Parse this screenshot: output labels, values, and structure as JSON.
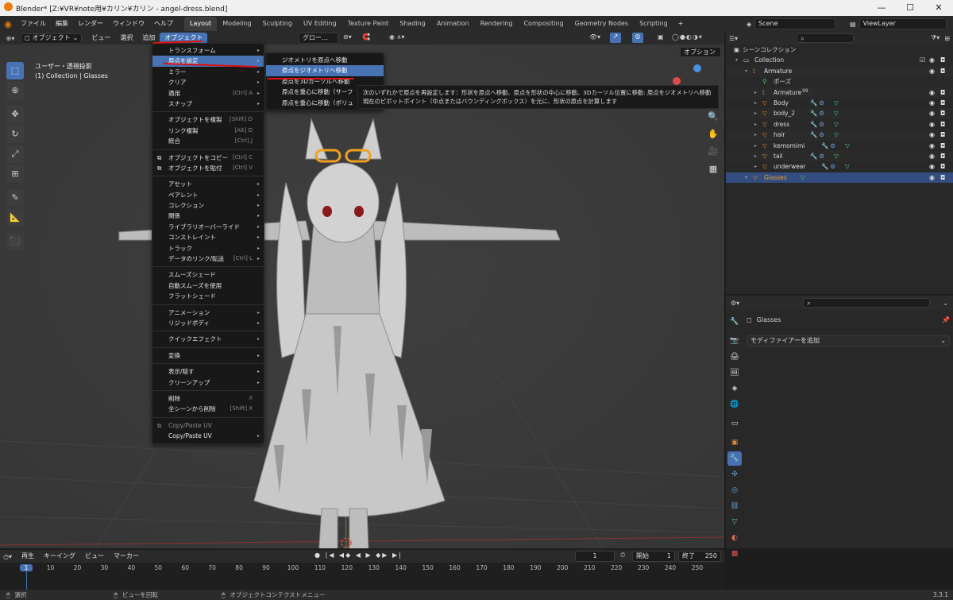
{
  "window": {
    "title": "Blender* [Z:¥VR¥note用¥カリン¥カリン - angel-dress.blend]",
    "minimize": "—",
    "maximize": "☐",
    "close": "✕"
  },
  "topbar": {
    "menus": [
      "ファイル",
      "編集",
      "レンダー",
      "ウィンドウ",
      "ヘルプ"
    ],
    "workspaces": [
      "Layout",
      "Modeling",
      "Sculpting",
      "UV Editing",
      "Texture Paint",
      "Shading",
      "Animation",
      "Rendering",
      "Compositing",
      "Geometry Nodes",
      "Scripting"
    ],
    "active_workspace": "Layout",
    "add_tab": "+",
    "scene": "Scene",
    "view_layer": "ViewLayer"
  },
  "viewport_header": {
    "mode": "オブジェクト",
    "menus": [
      "ビュー",
      "選択",
      "追加"
    ],
    "active_menu": "オブジェクト",
    "transform_orientation": "グロー…",
    "options_button": "オプション"
  },
  "viewport": {
    "view_name": "ユーザー・透視投影",
    "collection_info": "(1) Collection | Glasses"
  },
  "object_menu": {
    "items": [
      {
        "label": "トランスフォーム",
        "shortcut": "",
        "submenu": true
      },
      {
        "label": "原点を設定",
        "shortcut": "",
        "submenu": true,
        "highlight": true
      },
      {
        "label": "ミラー",
        "shortcut": "",
        "submenu": true
      },
      {
        "label": "クリア",
        "shortcut": "",
        "submenu": true
      },
      {
        "label": "適用",
        "shortcut": "[Ctrl] A",
        "submenu": true
      },
      {
        "label": "スナップ",
        "shortcut": "",
        "submenu": true
      },
      {
        "sep": true
      },
      {
        "label": "オブジェクトを複製",
        "shortcut": "[Shift] D"
      },
      {
        "label": "リンク複製",
        "shortcut": "[Alt] D"
      },
      {
        "label": "統合",
        "shortcut": "[Ctrl] J"
      },
      {
        "sep": true
      },
      {
        "label": "オブジェクトをコピー",
        "shortcut": "[Ctrl] C",
        "icon": "⧉"
      },
      {
        "label": "オブジェクトを貼付",
        "shortcut": "[Ctrl] V",
        "icon": "⧉"
      },
      {
        "sep": true
      },
      {
        "label": "アセット",
        "shortcut": "",
        "submenu": true
      },
      {
        "label": "ペアレント",
        "shortcut": "",
        "submenu": true
      },
      {
        "label": "コレクション",
        "shortcut": "",
        "submenu": true
      },
      {
        "label": "関係",
        "shortcut": "",
        "submenu": true
      },
      {
        "label": "ライブラリオーバーライド",
        "shortcut": "",
        "submenu": true
      },
      {
        "label": "コンストレイント",
        "shortcut": "",
        "submenu": true
      },
      {
        "label": "トラック",
        "shortcut": "",
        "submenu": true
      },
      {
        "label": "データのリンク/転送",
        "shortcut": "[Ctrl] L",
        "submenu": true
      },
      {
        "sep": true
      },
      {
        "label": "スムーズシェード",
        "shortcut": ""
      },
      {
        "label": "自動スムーズを使用",
        "shortcut": ""
      },
      {
        "label": "フラットシェード",
        "shortcut": ""
      },
      {
        "sep": true
      },
      {
        "label": "アニメーション",
        "shortcut": "",
        "submenu": true
      },
      {
        "label": "リジッドボディ",
        "shortcut": "",
        "submenu": true
      },
      {
        "sep": true
      },
      {
        "label": "クイックエフェクト",
        "shortcut": "",
        "submenu": true
      },
      {
        "sep": true
      },
      {
        "label": "変換",
        "shortcut": "",
        "submenu": true
      },
      {
        "sep": true
      },
      {
        "label": "表示/隠す",
        "shortcut": "",
        "submenu": true
      },
      {
        "label": "クリーンアップ",
        "shortcut": "",
        "submenu": true
      },
      {
        "sep": true
      },
      {
        "label": "削除",
        "shortcut": "X"
      },
      {
        "label": "全シーンから削除",
        "shortcut": "[Shift] X"
      },
      {
        "sep": true
      },
      {
        "label": "Copy/Paste UV",
        "shortcut": "",
        "dim": true,
        "icon": "⧉"
      },
      {
        "label": "Copy/Paste UV",
        "shortcut": "",
        "submenu": true
      }
    ]
  },
  "origin_submenu": {
    "items": [
      {
        "label": "ジオメトリを原点へ移動",
        "highlight": false
      },
      {
        "label": "原点をジオメトリへ移動",
        "highlight": true
      },
      {
        "label": "原点を3Dカーソルへ移動",
        "highlight": false
      },
      {
        "label": "原点を重心に移動（サーフ",
        "highlight": false
      },
      {
        "label": "原点を重心に移動（ボリュ",
        "highlight": false
      }
    ]
  },
  "tooltip": {
    "line1": "次のいずれかで原点を再設定します：形状を原点へ移動、原点を形状の中心に移動、3Dカーソル位置に移動: 原点をジオメトリへ移動",
    "line2": "現在のピボットポイント（中点またはバウンディングボックス）を元に、形状の原点を計算します"
  },
  "outliner": {
    "title": "シーンコレクション",
    "rows": [
      {
        "label": "Collection",
        "indent": 1,
        "icon": "collection",
        "checkbox": true
      },
      {
        "label": "Armature",
        "indent": 2,
        "icon": "armature"
      },
      {
        "label": "ポーズ",
        "indent": 3,
        "icon": "pose"
      },
      {
        "label": "Armature",
        "indent": 3,
        "icon": "armature-data",
        "extra": "99"
      },
      {
        "label": "Body",
        "indent": 3,
        "icon": "mesh"
      },
      {
        "label": "body_2",
        "indent": 3,
        "icon": "mesh"
      },
      {
        "label": "dress",
        "indent": 3,
        "icon": "mesh"
      },
      {
        "label": "hair",
        "indent": 3,
        "icon": "mesh"
      },
      {
        "label": "kemomimi",
        "indent": 3,
        "icon": "mesh"
      },
      {
        "label": "tail",
        "indent": 3,
        "icon": "mesh"
      },
      {
        "label": "underwear",
        "indent": 3,
        "icon": "mesh"
      },
      {
        "label": "Glasses",
        "indent": 2,
        "icon": "mesh",
        "selected": true
      }
    ]
  },
  "properties": {
    "object_name": "Glasses",
    "add_modifier": "モディファイアーを追加"
  },
  "timeline": {
    "menus": [
      "再生",
      "キーイング",
      "ビュー",
      "マーカー"
    ],
    "current_frame": "1",
    "start_label": "開始",
    "start": "1",
    "end_label": "終了",
    "end": "250",
    "ticks": [
      "1",
      "10",
      "20",
      "30",
      "40",
      "50",
      "60",
      "70",
      "80",
      "90",
      "100",
      "110",
      "120",
      "130",
      "140",
      "150",
      "160",
      "170",
      "180",
      "190",
      "200",
      "210",
      "220",
      "230",
      "240",
      "250"
    ]
  },
  "statusbar": {
    "select": "選択",
    "rotate": "ビューを回転",
    "context": "オブジェクトコンテクストメニュー",
    "version": "3.3.1"
  },
  "colors": {
    "accent": "#4772b3",
    "annotation": "#dd1111",
    "mesh_icon": "#e08a2e",
    "modifier_icon": "#6ea6e0",
    "data_icon": "#4fcf6e"
  }
}
